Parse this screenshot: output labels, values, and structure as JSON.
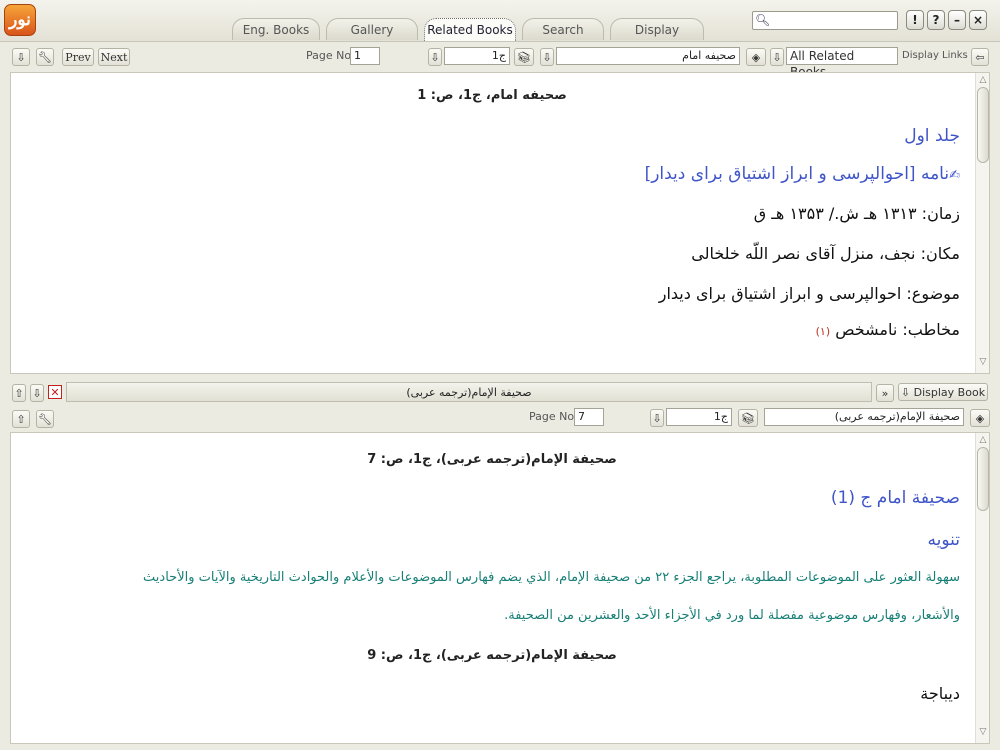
{
  "app": {
    "logo_text": "نور"
  },
  "tabs": [
    {
      "label": "Eng. Books"
    },
    {
      "label": "Gallery"
    },
    {
      "label": "Related Books"
    },
    {
      "label": "Search"
    },
    {
      "label": "Display"
    }
  ],
  "window_buttons": {
    "exclaim": "!",
    "help": "?",
    "minimize": "–",
    "close": "×"
  },
  "top_toolbar": {
    "prev_label": "Prev",
    "next_label": "Next",
    "page_no_label": "Page No",
    "page_no_value": "1",
    "volume_value": "ج1",
    "book_value": "صحیفه امام",
    "filter_value": "All Related Books",
    "display_links_label": "Display Links"
  },
  "top_content": {
    "page_header": "صحیفه امام، ج1، ص: 1",
    "lines": [
      {
        "text": "جلد اول",
        "style": "blue"
      },
      {
        "text": "نامه [احوالپرسی و ابراز اشتیاق برای دیدار]",
        "style": "blue"
      },
      {
        "text": "زمان: ۱۳۱۳ هـ ش./ ۱۳۵۳ هـ ق",
        "style": "black"
      },
      {
        "text": "مکان: نجف، منزل آقای نصر اللّه خلخالی",
        "style": "black"
      },
      {
        "text": "موضوع: احوالپرسی و ابراز اشتیاق برای دیدار",
        "style": "black"
      },
      {
        "text": "مخاطب: نامشخص",
        "style": "black",
        "footnote": "(۱)"
      }
    ]
  },
  "divider": {
    "book_title": "صحيفة الإمام(ترجمه عربى)",
    "display_book_label": "Display Book"
  },
  "bottom_toolbar": {
    "page_no_label": "Page No",
    "page_no_value": "7",
    "volume_value": "ج1",
    "book_value": "صحيفة الإمام(ترجمه عربى)"
  },
  "bottom_content": {
    "page_header_1": "صحيفة الإمام(ترجمه عربى)، ج1، ص: 7",
    "title": "صحيفة امام ج (1)",
    "subtitle": "تنويه",
    "para_line1": "سهولة العثور على الموضوعات المطلوبة، يراجع الجزء ٢٢ من صحيفة الإمام، الذي يضم فهارس الموضوعات والأعلام والحوادث التاريخية والآيات والأحاديث",
    "para_line2": "والأشعار، وفهارس موضوعية مفصلة لما ورد في الأجزاء الأحد والعشرين من الصحيفة.",
    "page_header_2": "صحيفة الإمام(ترجمه عربى)، ج1، ص: 9",
    "heading": "ديباجة"
  }
}
